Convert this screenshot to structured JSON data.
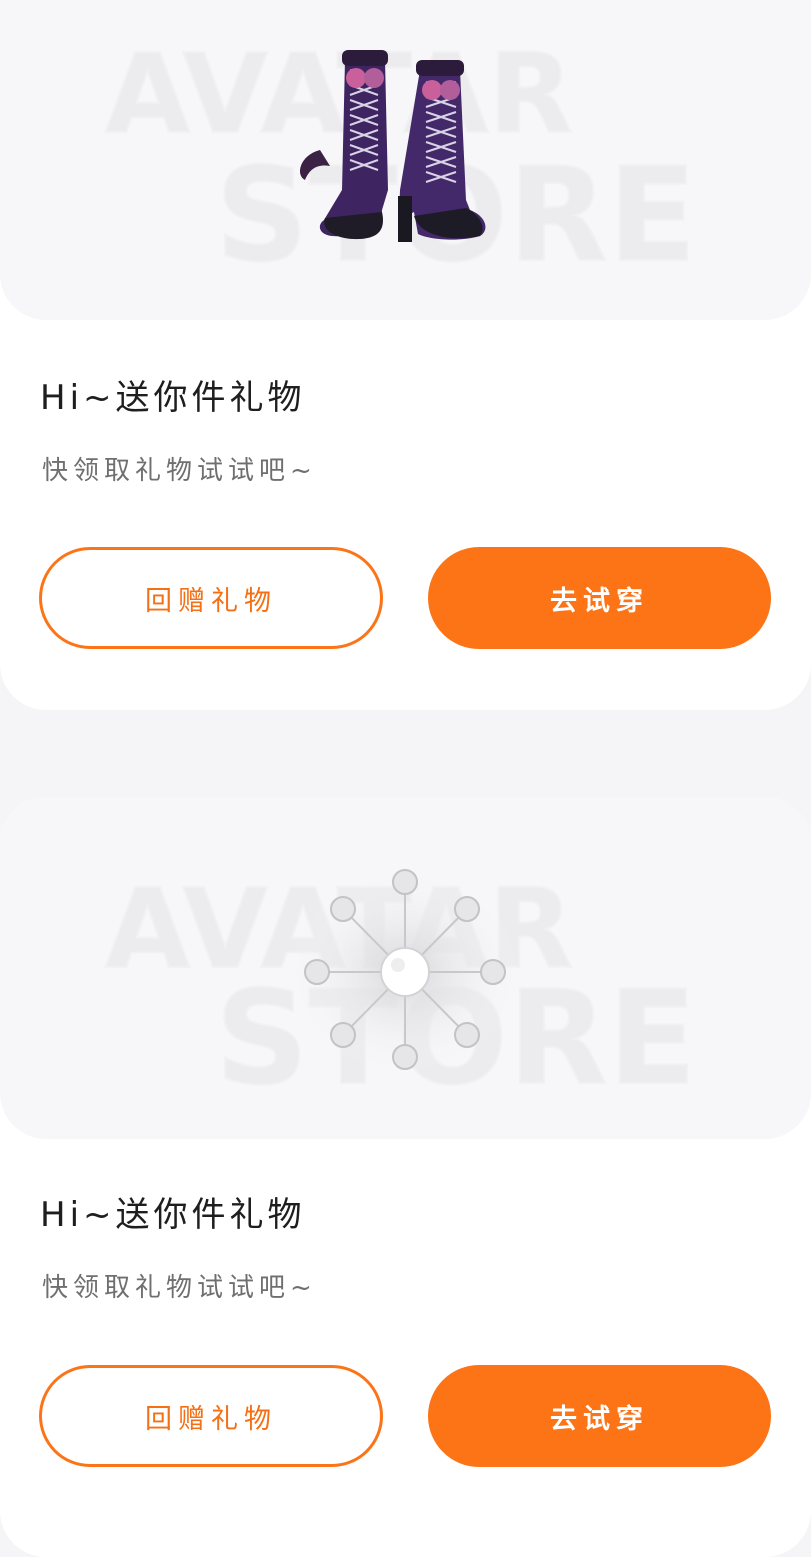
{
  "gifts": [
    {
      "item_icon": "purple-lace-boots",
      "title": "Hi~送你件礼物",
      "subtitle": "快领取礼物试试吧~",
      "buttons": {
        "return_gift": "回赠礼物",
        "try_on": "去试穿"
      }
    },
    {
      "item_icon": "white-orb-accessory",
      "title": "Hi~送你件礼物",
      "subtitle": "快领取礼物试试吧~",
      "buttons": {
        "return_gift": "回赠礼物",
        "try_on": "去试穿"
      }
    }
  ],
  "watermark": {
    "line1": "AVATAR",
    "line2": "STORE"
  },
  "colors": {
    "accent": "#FC7415",
    "page_bg": "#F5F5F7",
    "card_bg": "#FFFFFF",
    "image_bg": "#F7F7F9",
    "title": "#1E1E1E",
    "subtitle": "#6F6F6F"
  }
}
